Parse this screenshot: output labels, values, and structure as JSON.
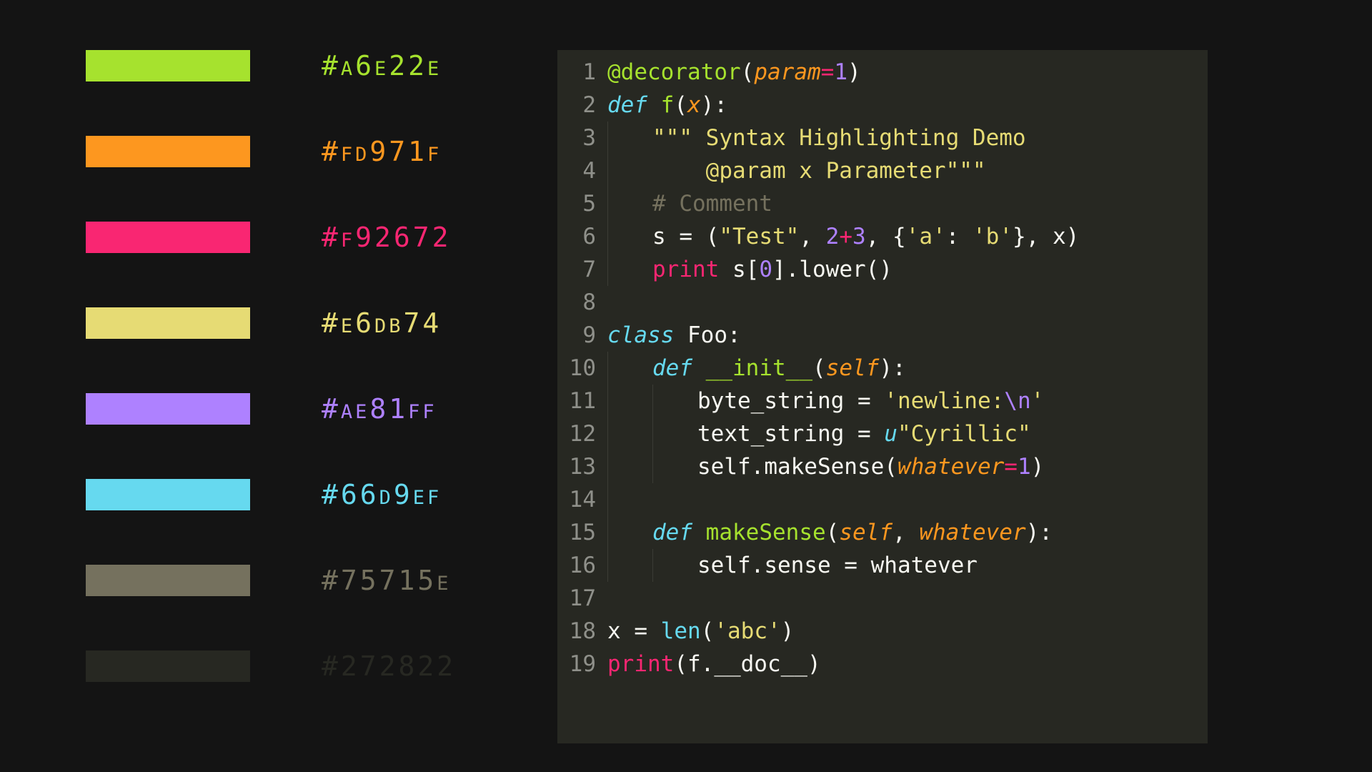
{
  "palette": [
    {
      "hex": "#A6E22E",
      "label": "#A6E22E"
    },
    {
      "hex": "#FD971F",
      "label": "#FD971F"
    },
    {
      "hex": "#F92672",
      "label": "#F92672"
    },
    {
      "hex": "#E6DB74",
      "label": "#E6DB74"
    },
    {
      "hex": "#AE81FF",
      "label": "#AE81FF"
    },
    {
      "hex": "#66D9EF",
      "label": "#66D9EF"
    },
    {
      "hex": "#75715E",
      "label": "#75715E"
    },
    {
      "hex": "#272822",
      "label": "#272822"
    }
  ],
  "code": {
    "line_numbers": [
      "1",
      "2",
      "3",
      "4",
      "5",
      "6",
      "7",
      "8",
      "9",
      "10",
      "11",
      "12",
      "13",
      "14",
      "15",
      "16",
      "17",
      "18",
      "19"
    ],
    "tokens": {
      "l1_at": "@",
      "l1_decorator": "decorator",
      "l1_open": "(",
      "l1_param": "param",
      "l1_eq": "=",
      "l1_num": "1",
      "l1_close": ")",
      "l2_def": "def",
      "l2_name": "f",
      "l2_open": "(",
      "l2_arg": "x",
      "l2_close": "):",
      "l3_doc": "\"\"\" Syntax Highlighting Demo",
      "l4_doc": "    @param x Parameter\"\"\"",
      "l5_comment": "# Comment",
      "l6_s": "s",
      "l6_eq": " = ",
      "l6_open": "(",
      "l6_str": "\"Test\"",
      "l6_comma1": ", ",
      "l6_n2": "2",
      "l6_plus": "+",
      "l6_n3": "3",
      "l6_comma2": ", ",
      "l6_brace_o": "{",
      "l6_ka": "'a'",
      "l6_colon": ": ",
      "l6_vb": "'b'",
      "l6_brace_c": "}",
      "l6_comma3": ", x",
      "l6_close": ")",
      "l7_print": "print",
      "l7_rest1": " s[",
      "l7_zero": "0",
      "l7_rest2": "].lower()",
      "l9_class": "class",
      "l9_name": " Foo:",
      "l10_def": "def",
      "l10_name": "__init__",
      "l10_open": "(",
      "l10_self": "self",
      "l10_close": "):",
      "l11_pre": "byte_string = ",
      "l11_str": "'newline:",
      "l11_esc": "\\n",
      "l11_strend": "'",
      "l12_pre": "text_string = ",
      "l12_u": "u",
      "l12_str": "\"Cyrillic\"",
      "l13_pre": "self.makeSense(",
      "l13_kw": "whatever",
      "l13_eq": "=",
      "l13_num": "1",
      "l13_close": ")",
      "l15_def": "def",
      "l15_name": "makeSense",
      "l15_open": "(",
      "l15_self": "self",
      "l15_comma": ", ",
      "l15_arg": "whatever",
      "l15_close": "):",
      "l16_body": "self.sense = whatever",
      "l18_pre": "x = ",
      "l18_len": "len",
      "l18_open": "(",
      "l18_str": "'abc'",
      "l18_close": ")",
      "l19_print": "print",
      "l19_rest": "(f.__doc__)"
    }
  }
}
